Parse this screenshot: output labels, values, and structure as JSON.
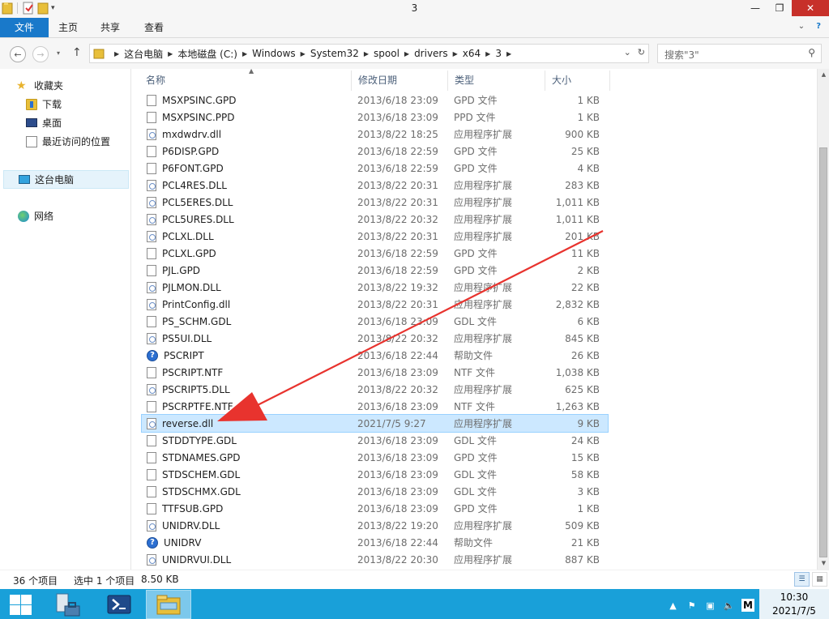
{
  "window": {
    "title": "3",
    "minimize": "—",
    "restore": "❐",
    "close": "✕"
  },
  "ribbon": {
    "tabs": [
      {
        "label": "文件"
      },
      {
        "label": "主页"
      },
      {
        "label": "共享"
      },
      {
        "label": "查看"
      }
    ]
  },
  "address": {
    "crumbs": [
      "这台电脑",
      "本地磁盘 (C:)",
      "Windows",
      "System32",
      "spool",
      "drivers",
      "x64",
      "3"
    ],
    "search_placeholder": "搜索\"3\""
  },
  "nav": {
    "favorites": "收藏夹",
    "downloads": "下载",
    "desktop": "桌面",
    "recent": "最近访问的位置",
    "this_pc": "这台电脑",
    "network": "网络"
  },
  "columns": {
    "name": "名称",
    "date": "修改日期",
    "type": "类型",
    "size": "大小"
  },
  "files": [
    {
      "name": "MSXPSINC.GPD",
      "date": "2013/6/18 23:09",
      "type": "GPD 文件",
      "size": "1 KB",
      "icon": "file"
    },
    {
      "name": "MSXPSINC.PPD",
      "date": "2013/6/18 23:09",
      "type": "PPD 文件",
      "size": "1 KB",
      "icon": "file"
    },
    {
      "name": "mxdwdrv.dll",
      "date": "2013/8/22 18:25",
      "type": "应用程序扩展",
      "size": "900 KB",
      "icon": "dll"
    },
    {
      "name": "P6DISP.GPD",
      "date": "2013/6/18 22:59",
      "type": "GPD 文件",
      "size": "25 KB",
      "icon": "file"
    },
    {
      "name": "P6FONT.GPD",
      "date": "2013/6/18 22:59",
      "type": "GPD 文件",
      "size": "4 KB",
      "icon": "file"
    },
    {
      "name": "PCL4RES.DLL",
      "date": "2013/8/22 20:31",
      "type": "应用程序扩展",
      "size": "283 KB",
      "icon": "dll"
    },
    {
      "name": "PCL5ERES.DLL",
      "date": "2013/8/22 20:31",
      "type": "应用程序扩展",
      "size": "1,011 KB",
      "icon": "dll"
    },
    {
      "name": "PCL5URES.DLL",
      "date": "2013/8/22 20:32",
      "type": "应用程序扩展",
      "size": "1,011 KB",
      "icon": "dll"
    },
    {
      "name": "PCLXL.DLL",
      "date": "2013/8/22 20:31",
      "type": "应用程序扩展",
      "size": "201 KB",
      "icon": "dll"
    },
    {
      "name": "PCLXL.GPD",
      "date": "2013/6/18 22:59",
      "type": "GPD 文件",
      "size": "11 KB",
      "icon": "file"
    },
    {
      "name": "PJL.GPD",
      "date": "2013/6/18 22:59",
      "type": "GPD 文件",
      "size": "2 KB",
      "icon": "file"
    },
    {
      "name": "PJLMON.DLL",
      "date": "2013/8/22 19:32",
      "type": "应用程序扩展",
      "size": "22 KB",
      "icon": "dll"
    },
    {
      "name": "PrintConfig.dll",
      "date": "2013/8/22 20:31",
      "type": "应用程序扩展",
      "size": "2,832 KB",
      "icon": "dll"
    },
    {
      "name": "PS_SCHM.GDL",
      "date": "2013/6/18 23:09",
      "type": "GDL 文件",
      "size": "6 KB",
      "icon": "file"
    },
    {
      "name": "PS5UI.DLL",
      "date": "2013/8/22 20:32",
      "type": "应用程序扩展",
      "size": "845 KB",
      "icon": "dll"
    },
    {
      "name": "PSCRIPT",
      "date": "2013/6/18 22:44",
      "type": "帮助文件",
      "size": "26 KB",
      "icon": "help"
    },
    {
      "name": "PSCRIPT.NTF",
      "date": "2013/6/18 23:09",
      "type": "NTF 文件",
      "size": "1,038 KB",
      "icon": "file"
    },
    {
      "name": "PSCRIPT5.DLL",
      "date": "2013/8/22 20:32",
      "type": "应用程序扩展",
      "size": "625 KB",
      "icon": "dll"
    },
    {
      "name": "PSCRPTFE.NTF",
      "date": "2013/6/18 23:09",
      "type": "NTF 文件",
      "size": "1,263 KB",
      "icon": "file"
    },
    {
      "name": "reverse.dll",
      "date": "2021/7/5 9:27",
      "type": "应用程序扩展",
      "size": "9 KB",
      "icon": "dll",
      "selected": true
    },
    {
      "name": "STDDTYPE.GDL",
      "date": "2013/6/18 23:09",
      "type": "GDL 文件",
      "size": "24 KB",
      "icon": "file"
    },
    {
      "name": "STDNAMES.GPD",
      "date": "2013/6/18 23:09",
      "type": "GPD 文件",
      "size": "15 KB",
      "icon": "file"
    },
    {
      "name": "STDSCHEM.GDL",
      "date": "2013/6/18 23:09",
      "type": "GDL 文件",
      "size": "58 KB",
      "icon": "file"
    },
    {
      "name": "STDSCHMX.GDL",
      "date": "2013/6/18 23:09",
      "type": "GDL 文件",
      "size": "3 KB",
      "icon": "file"
    },
    {
      "name": "TTFSUB.GPD",
      "date": "2013/6/18 23:09",
      "type": "GPD 文件",
      "size": "1 KB",
      "icon": "file"
    },
    {
      "name": "UNIDRV.DLL",
      "date": "2013/8/22 19:20",
      "type": "应用程序扩展",
      "size": "509 KB",
      "icon": "dll"
    },
    {
      "name": "UNIDRV",
      "date": "2013/6/18 22:44",
      "type": "帮助文件",
      "size": "21 KB",
      "icon": "help"
    },
    {
      "name": "UNIDRVUI.DLL",
      "date": "2013/8/22 20:30",
      "type": "应用程序扩展",
      "size": "887 KB",
      "icon": "dll"
    }
  ],
  "status": {
    "item_count": "36 个项目",
    "selection": "选中 1 个项目",
    "selection_size": "8.50 KB"
  },
  "taskbar": {
    "ime": "M",
    "time": "10:30",
    "date": "2021/7/5"
  },
  "colors": {
    "accent": "#1979ca",
    "taskbar": "#19a0d9",
    "selection": "#cce8ff",
    "annotation_arrow": "#e8332e"
  }
}
